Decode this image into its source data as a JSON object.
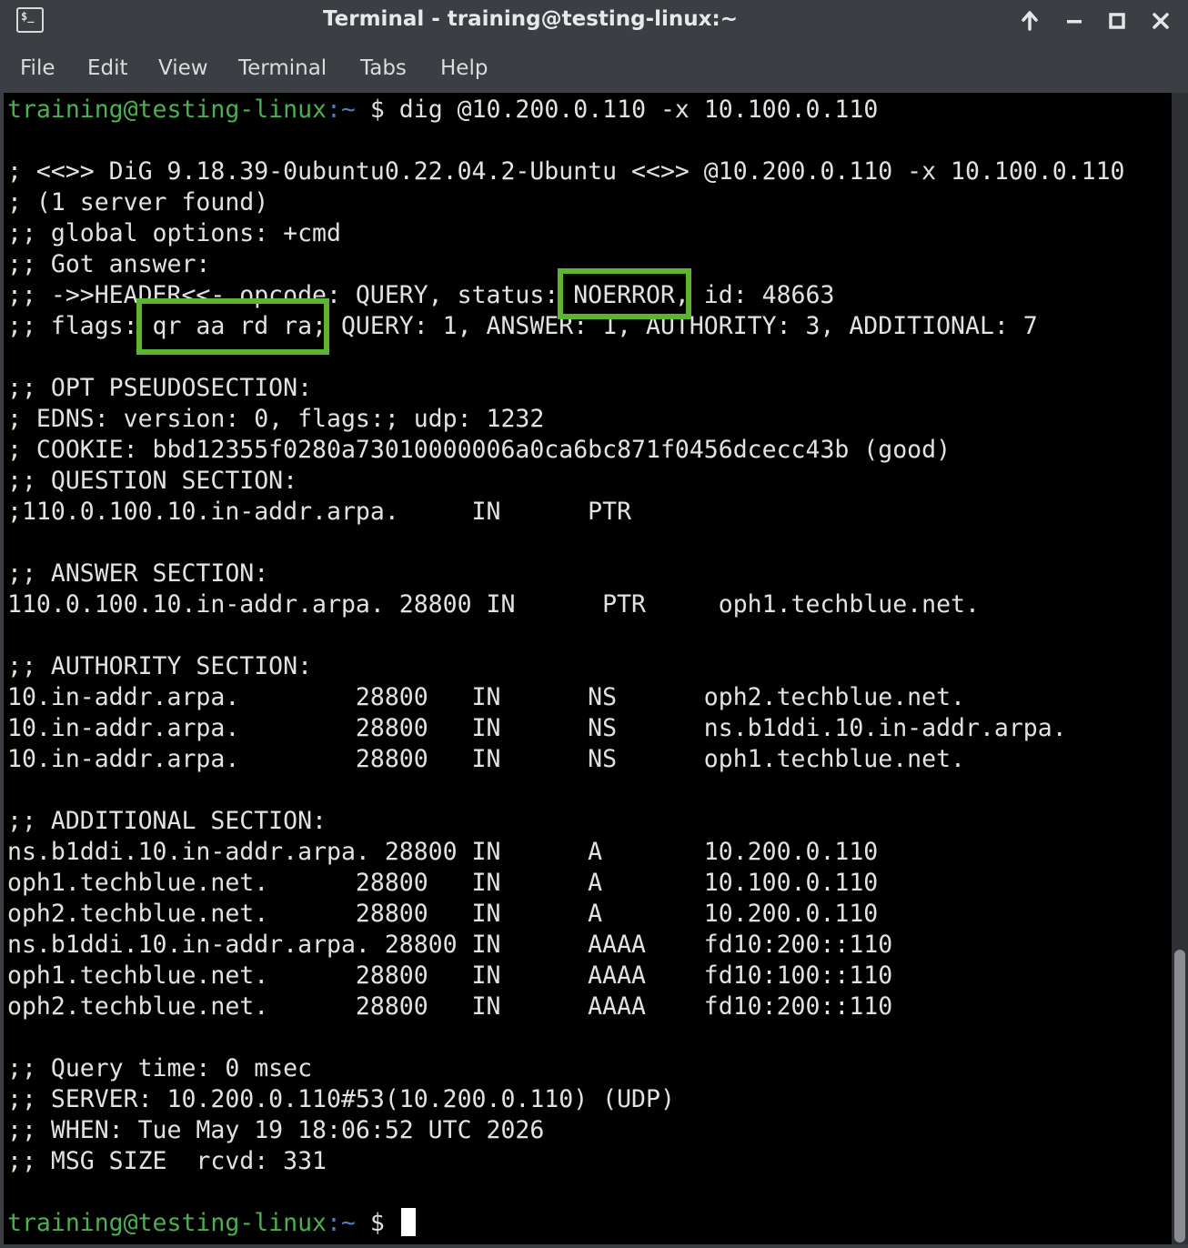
{
  "window": {
    "title": "Terminal - training@testing-linux:~",
    "icon": "terminal-icon",
    "app_icon_glyph": "$_",
    "controls": [
      "keep-above-icon",
      "minimize-icon",
      "maximize-icon",
      "close-icon"
    ]
  },
  "menu": {
    "items": [
      "File",
      "Edit",
      "View",
      "Terminal",
      "Tabs",
      "Help"
    ]
  },
  "prompt": {
    "user_host": "training@testing-linux",
    "path": ":~",
    "symbol": " $ "
  },
  "command": "dig @10.200.0.110 -x 10.100.0.110",
  "output": [
    "",
    "; <<>> DiG 9.18.39-0ubuntu0.22.04.2-Ubuntu <<>> @10.200.0.110 -x 10.100.0.110",
    "; (1 server found)",
    ";; global options: +cmd",
    ";; Got answer:",
    ";; ->>HEADER<<- opcode: QUERY, status: NOERROR, id: 48663",
    ";; flags: qr aa rd ra; QUERY: 1, ANSWER: 1, AUTHORITY: 3, ADDITIONAL: 7",
    "",
    ";; OPT PSEUDOSECTION:",
    "; EDNS: version: 0, flags:; udp: 1232",
    "; COOKIE: bbd12355f0280a73010000006a0ca6bc871f0456dcecc43b (good)",
    ";; QUESTION SECTION:",
    ";110.0.100.10.in-addr.arpa.     IN      PTR",
    "",
    ";; ANSWER SECTION:",
    "110.0.100.10.in-addr.arpa. 28800 IN      PTR     oph1.techblue.net.",
    "",
    ";; AUTHORITY SECTION:",
    "10.in-addr.arpa.        28800   IN      NS      oph2.techblue.net.",
    "10.in-addr.arpa.        28800   IN      NS      ns.b1ddi.10.in-addr.arpa.",
    "10.in-addr.arpa.        28800   IN      NS      oph1.techblue.net.",
    "",
    ";; ADDITIONAL SECTION:",
    "ns.b1ddi.10.in-addr.arpa. 28800 IN      A       10.200.0.110",
    "oph1.techblue.net.      28800   IN      A       10.100.0.110",
    "oph2.techblue.net.      28800   IN      A       10.200.0.110",
    "ns.b1ddi.10.in-addr.arpa. 28800 IN      AAAA    fd10:200::110",
    "oph1.techblue.net.      28800   IN      AAAA    fd10:100::110",
    "oph2.techblue.net.      28800   IN      AAAA    fd10:200::110",
    "",
    ";; Query time: 0 msec",
    ";; SERVER: 10.200.0.110#53(10.200.0.110) (UDP)",
    ";; WHEN: Tue May 19 18:06:52 UTC 2026",
    ";; MSG SIZE  rcvd: 331",
    ""
  ],
  "highlights": [
    {
      "label": "NOERROR"
    },
    {
      "label": "qr aa rd ra"
    }
  ],
  "colors": {
    "prompt_user": "#4caf50",
    "prompt_path": "#4a7fc1",
    "highlight_border": "#5cb531",
    "terminal_bg": "#000000",
    "terminal_fg": "#e2e2e2",
    "chrome_bg": "#3b3e42"
  }
}
